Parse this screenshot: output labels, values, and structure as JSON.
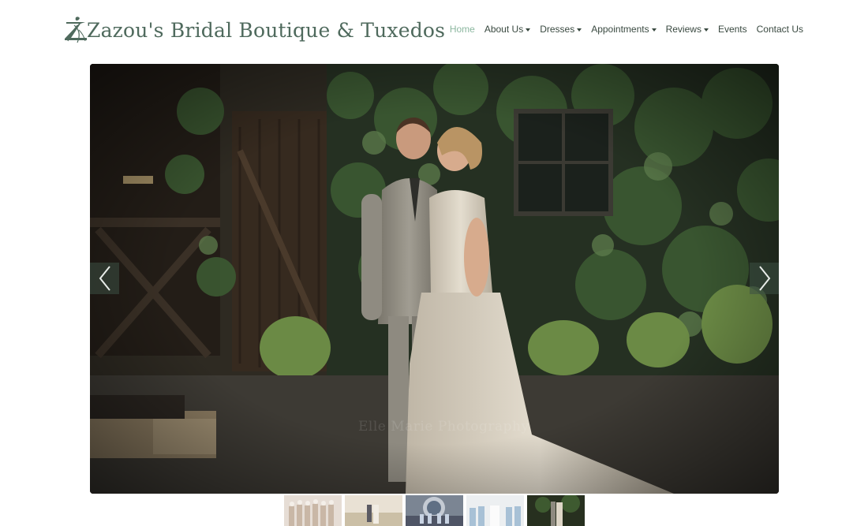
{
  "brand": {
    "name": "Zazou's Bridal Boutique & Tuxedos",
    "logo_icon": "bride-silhouette-logo",
    "color": "#4f6a5d"
  },
  "nav": {
    "items": [
      {
        "label": "Home",
        "active": true,
        "dropdown": false
      },
      {
        "label": "About Us",
        "active": false,
        "dropdown": true
      },
      {
        "label": "Dresses",
        "active": false,
        "dropdown": true
      },
      {
        "label": "Appointments",
        "active": false,
        "dropdown": true
      },
      {
        "label": "Reviews",
        "active": false,
        "dropdown": true
      },
      {
        "label": "Events",
        "active": false,
        "dropdown": false
      },
      {
        "label": "Contact Us",
        "active": false,
        "dropdown": false
      }
    ],
    "active_color": "#8bb79f",
    "text_color": "#38483f"
  },
  "carousel": {
    "slide_description": "Couple kissing in front of ivy-covered wall",
    "watermark": "Elle Marie Photography",
    "prev_icon": "chevron-left-icon",
    "next_icon": "chevron-right-icon",
    "thumbnails": [
      {
        "name": "thumb-bridesmaids",
        "active": false
      },
      {
        "name": "thumb-couple-field",
        "active": false
      },
      {
        "name": "thumb-group-arch",
        "active": false
      },
      {
        "name": "thumb-bridesmaids-blue",
        "active": false
      },
      {
        "name": "thumb-couple-ivy",
        "active": true
      }
    ]
  }
}
